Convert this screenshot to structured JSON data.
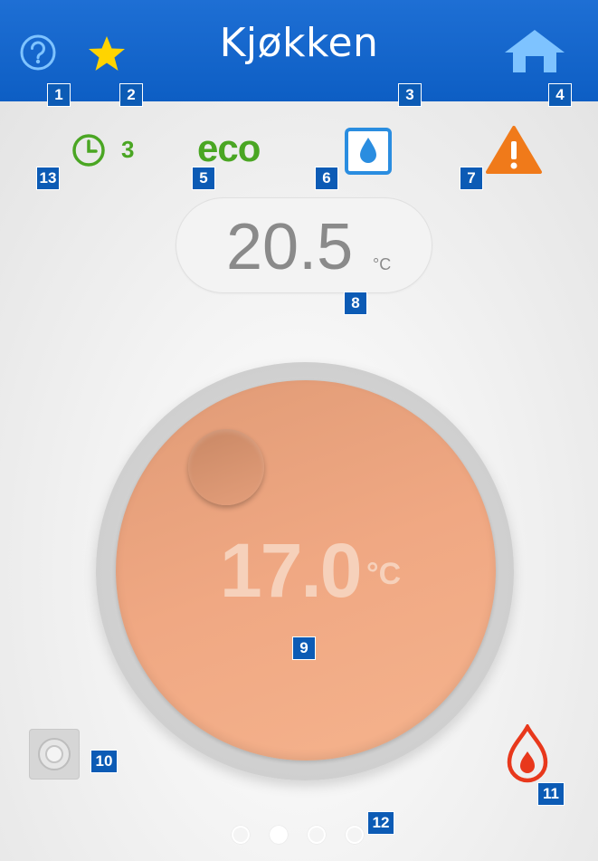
{
  "header": {
    "title": "Kjøkken"
  },
  "status": {
    "schedule_number": "3",
    "eco_label": "eco"
  },
  "current": {
    "temperature": "20.5",
    "unit": "°C"
  },
  "setpoint": {
    "temperature": "17.0",
    "unit": "°C"
  },
  "pager": {
    "page_count": 4,
    "active_index": 1
  },
  "badges": {
    "help": "1",
    "favorite": "2",
    "title": "3",
    "home": "4",
    "eco": "5",
    "humidity": "6",
    "warning": "7",
    "current_temp": "8",
    "dial": "9",
    "device": "10",
    "heating": "11",
    "pager": "12",
    "schedule": "13"
  },
  "colors": {
    "header": "#0d5ec4",
    "eco_green": "#4aa623",
    "dial": "#f0a883",
    "warning": "#f07a1a",
    "flame": "#e8381c",
    "star": "#ffd400"
  },
  "icons": {
    "help": "help-icon",
    "favorite": "star-icon",
    "home": "home-icon",
    "schedule": "clock-icon",
    "humidity": "water-drop-icon",
    "warning": "warning-icon",
    "heating": "flame-icon",
    "device": "device-icon"
  }
}
